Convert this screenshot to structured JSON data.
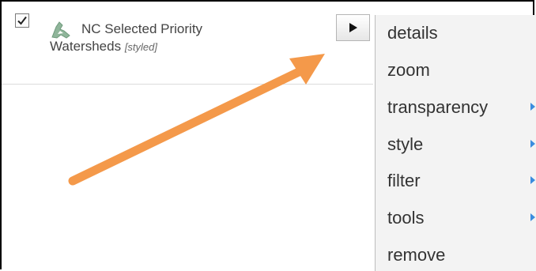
{
  "layer": {
    "checked": true,
    "icon": "polygon-layer-icon",
    "name_line1": "NC Selected Priority",
    "name_line2": "Watersheds",
    "tag": "[styled]"
  },
  "menu_button": {
    "icon": "play-right-triangle-icon"
  },
  "context_menu": {
    "items": [
      {
        "label": "details",
        "has_submenu": false
      },
      {
        "label": "zoom",
        "has_submenu": false
      },
      {
        "label": "transparency",
        "has_submenu": true
      },
      {
        "label": "style",
        "has_submenu": true
      },
      {
        "label": "filter",
        "has_submenu": true
      },
      {
        "label": "tools",
        "has_submenu": true
      },
      {
        "label": "remove",
        "has_submenu": false
      }
    ]
  },
  "annotation": {
    "color": "#f4994a"
  }
}
